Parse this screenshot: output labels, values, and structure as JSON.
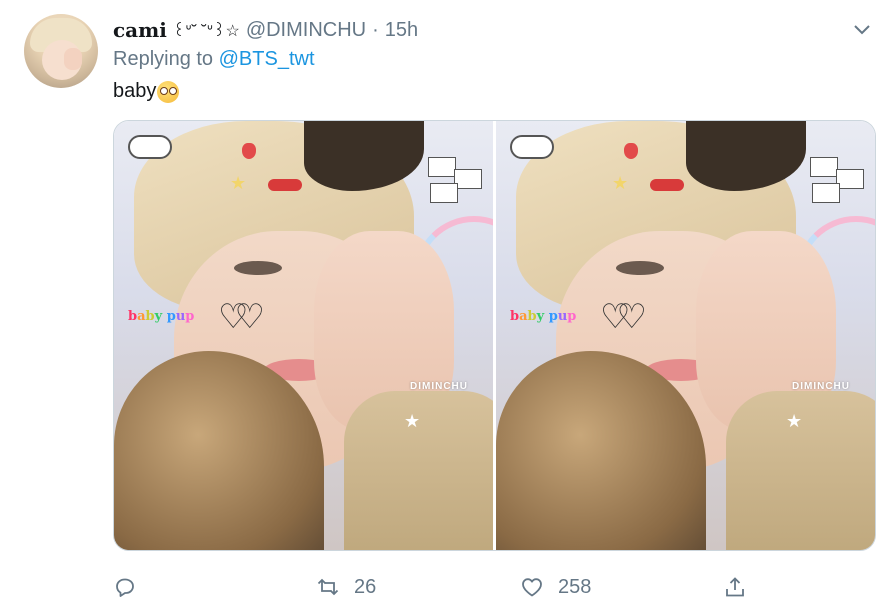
{
  "tweet": {
    "display_name": "cami",
    "name_emoji": "꒰ᐡ˘ ˘ᐡ꒱☆",
    "handle": "@DIMINCHU",
    "separator": "·",
    "time": "15h",
    "replying_prefix": "Replying to",
    "replying_to": "@BTS_twt",
    "text": "baby",
    "text_emoji": "pleading-face-emoji",
    "media": {
      "count": 2,
      "overlay_text_1": "baby pup",
      "watermark": "DIMINCHU"
    },
    "actions": {
      "reply_count": "",
      "retweet_count": "26",
      "like_count": "258"
    }
  },
  "icons": {
    "reply": "reply-icon",
    "retweet": "retweet-icon",
    "like": "heart-icon",
    "share": "share-icon",
    "caret": "chevron-down-icon"
  },
  "colors": {
    "link": "#1b95e0",
    "secondary_text": "#657786",
    "primary_text": "#14171a",
    "border": "#ccd6dd"
  }
}
